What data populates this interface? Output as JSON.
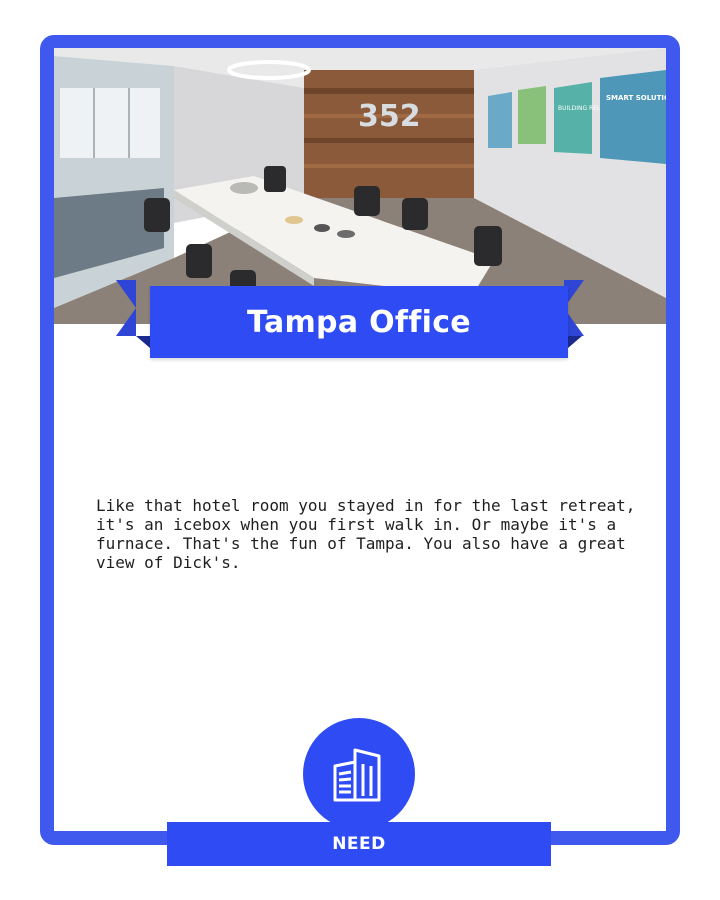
{
  "card": {
    "title": "Tampa Office",
    "description": "Like that hotel room you stayed in for the last retreat, it's an icebox when you first walk in. Or maybe it's a furnace. That's the fun of Tampa. You also have a great view of Dick's.",
    "category": "NEED",
    "icon": "office-building-icon"
  },
  "photo": {
    "wall_sign": "352",
    "posters": [
      "SMART SOLUTIONS",
      "BUILDING RELATIONSHIPS"
    ]
  },
  "colors": {
    "frame": "#3f59ee",
    "banner": "#2f4cf4",
    "ribbon_shadow": "#2e45d6",
    "text": "#1f1f1f"
  }
}
